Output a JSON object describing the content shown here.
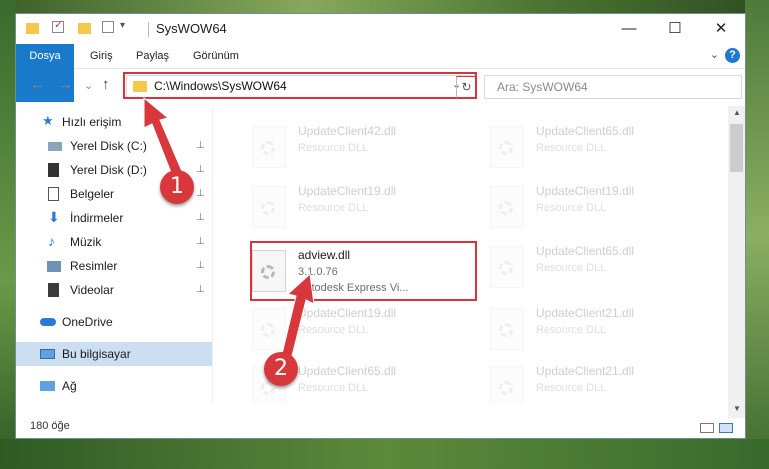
{
  "window": {
    "title": "SysWOW64",
    "min_label": "—",
    "max_label": "☐",
    "close_label": "✕"
  },
  "ribbon": {
    "tabs": [
      "Dosya",
      "Giriş",
      "Paylaş",
      "Görünüm"
    ],
    "help_label": "?",
    "expand_label": "⌄"
  },
  "nav": {
    "back": "←",
    "forward": "→",
    "recent": "⌄",
    "up": "↑",
    "address_path": "C:\\Windows\\SysWOW64",
    "address_dropdown": "⌄",
    "refresh": "↻",
    "search_placeholder": "Ara: SysWOW64"
  },
  "sidebar": {
    "items": [
      {
        "label": "Hızlı erişim",
        "icon": "star-icon",
        "pinned": false
      },
      {
        "label": "Yerel Disk (C:)",
        "icon": "drive-icon",
        "pinned": true
      },
      {
        "label": "Yerel Disk (D:)",
        "icon": "drive-icon",
        "pinned": true
      },
      {
        "label": "Belgeler",
        "icon": "documents-icon",
        "pinned": true
      },
      {
        "label": "İndirmeler",
        "icon": "download-icon",
        "pinned": true
      },
      {
        "label": "Müzik",
        "icon": "music-icon",
        "pinned": true
      },
      {
        "label": "Resimler",
        "icon": "pictures-icon",
        "pinned": true
      },
      {
        "label": "Videolar",
        "icon": "video-icon",
        "pinned": true
      },
      {
        "label": "OneDrive",
        "icon": "cloud-icon",
        "pinned": false
      },
      {
        "label": "Bu bilgisayar",
        "icon": "computer-icon",
        "pinned": false
      },
      {
        "label": "Ağ",
        "icon": "network-icon",
        "pinned": false
      }
    ],
    "pin_glyph": "📌"
  },
  "files": [
    {
      "name": "UpdateClient42.dll",
      "line2": "Resource DLL",
      "line3": ""
    },
    {
      "name": "UpdateClient65.dll",
      "line2": "Resource DLL",
      "line3": ""
    },
    {
      "name": "UpdateClient19.dll",
      "line2": "Resource DLL",
      "line3": ""
    },
    {
      "name": "UpdateClient19.dll",
      "line2": "Resource DLL",
      "line3": ""
    },
    {
      "name": "adview.dll",
      "line2": "3.1.0.76",
      "line3": "Autodesk Express Vi..."
    },
    {
      "name": "UpdateClient65.dll",
      "line2": "Resource DLL",
      "line3": ""
    },
    {
      "name": "UpdateClient19.dll",
      "line2": "Resource DLL",
      "line3": ""
    },
    {
      "name": "UpdateClient21.dll",
      "line2": "Resource DLL",
      "line3": ""
    },
    {
      "name": "UpdateClient65.dll",
      "line2": "Resource DLL",
      "line3": ""
    },
    {
      "name": "UpdateClient21.dll",
      "line2": "Resource DLL",
      "line3": ""
    }
  ],
  "status": {
    "count": "180 öğe"
  },
  "annotations": {
    "step1": "1",
    "step2": "2",
    "highlight_color": "#d6343b"
  },
  "colors": {
    "accent": "#1979ca",
    "selected_bg": "#ccdff2",
    "folder": "#f5c84c"
  }
}
